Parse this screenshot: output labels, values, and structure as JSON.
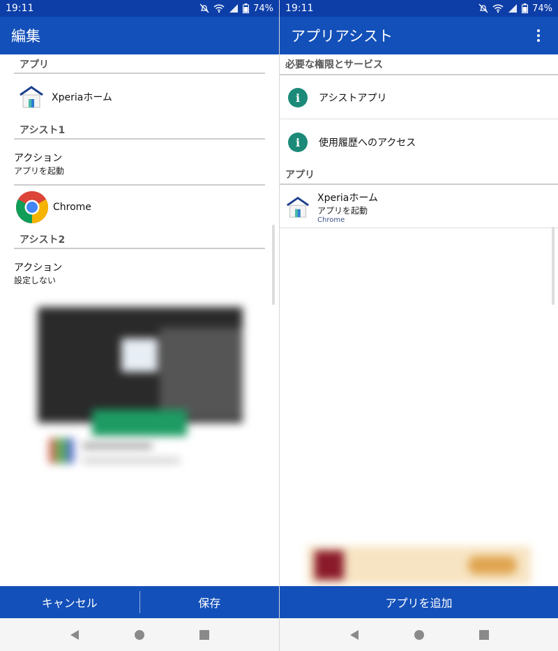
{
  "status": {
    "time": "19:11",
    "battery": "74%"
  },
  "left": {
    "title": "編集",
    "section_app": "アプリ",
    "app_name": "Xperiaホーム",
    "section_assist1": "アシスト1",
    "assist1_action_title": "アクション",
    "assist1_action_value": "アプリを起動",
    "assist1_app": "Chrome",
    "section_assist2": "アシスト2",
    "assist2_action_title": "アクション",
    "assist2_action_value": "設定しない",
    "cancel_label": "キャンセル",
    "save_label": "保存"
  },
  "right": {
    "title": "アプリアシスト",
    "section_perms": "必要な権限とサービス",
    "perm_assist": "アシストアプリ",
    "perm_usage": "使用履歴へのアクセス",
    "section_apps": "アプリ",
    "app_name": "Xperiaホーム",
    "app_action": "アプリを起動",
    "app_assist": "Chrome",
    "add_label": "アプリを追加"
  },
  "colors": {
    "status_bar": "#0d3ea8",
    "app_bar": "#1350b9",
    "info_icon": "#1b8a78"
  },
  "icons": [
    "notification-off-icon",
    "wifi-icon",
    "signal-icon",
    "battery-icon",
    "home-app-icon",
    "chrome-icon",
    "info-icon",
    "overflow-menu-icon",
    "back-icon",
    "home-icon",
    "recents-icon"
  ]
}
